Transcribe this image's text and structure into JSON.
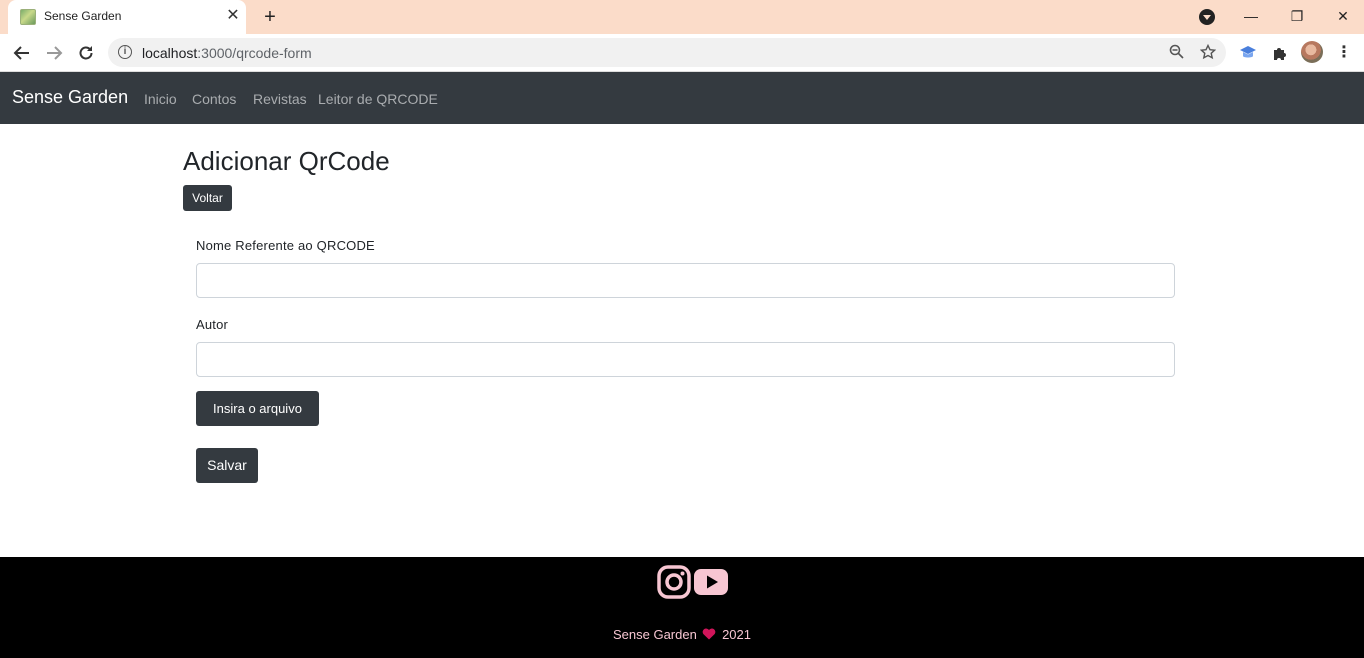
{
  "browser": {
    "tab_title": "Sense Garden",
    "tab_close": "✕",
    "new_tab": "+",
    "url_host": "localhost",
    "url_path": ":3000/qrcode-form",
    "window_minimize": "—",
    "window_restore": "❐",
    "window_close": "✕"
  },
  "navbar": {
    "brand": "Sense Garden",
    "links": [
      "Inicio",
      "Contos",
      "Revistas",
      "Leitor de QRCODE"
    ]
  },
  "page": {
    "title": "Adicionar QrCode",
    "back_button": "Voltar",
    "fields": [
      {
        "label": "Nome Referente ao QRCODE",
        "value": ""
      },
      {
        "label": "Autor",
        "value": ""
      }
    ],
    "file_button": "Insira o arquivo",
    "save_button": "Salvar"
  },
  "footer": {
    "brand": "Sense Garden",
    "year": "2021",
    "icons": [
      "instagram-icon",
      "youtube-icon",
      "heart-icon"
    ],
    "accent_color": "#f7c6d2",
    "heart_color": "#d0155a"
  },
  "colors": {
    "navbar_bg": "#343a40",
    "button_bg": "#343a40",
    "footer_bg": "#000000",
    "tabstrip_bg": "#fbdcc9"
  }
}
